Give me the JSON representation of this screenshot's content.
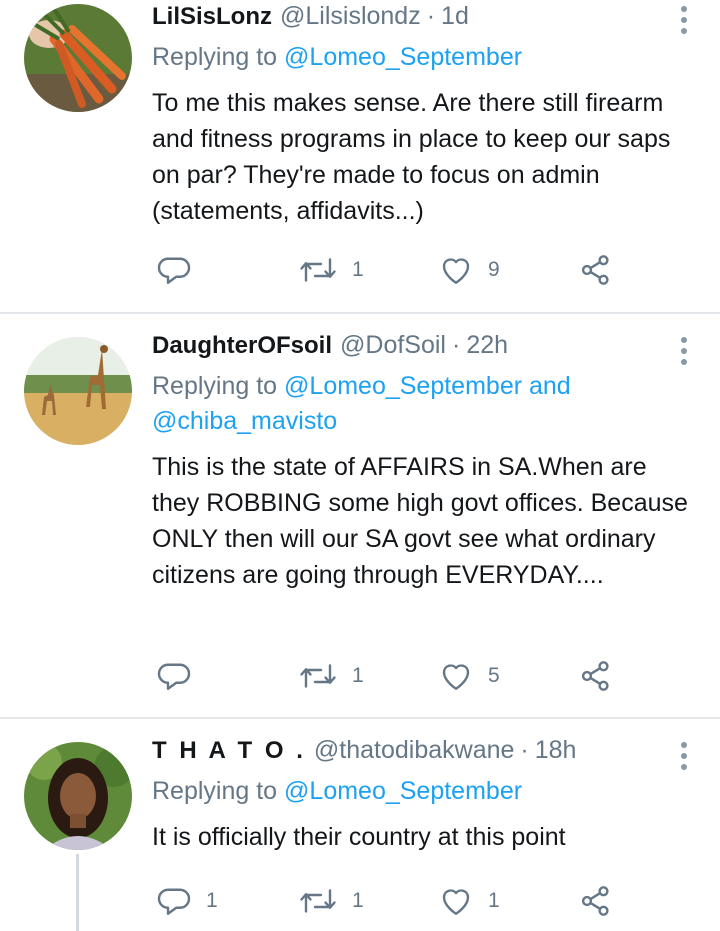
{
  "tweets": [
    {
      "name": "LilSisLonz",
      "handle": "@Lilsislondz",
      "dot": "·",
      "time": "1d",
      "replying_prefix": "Replying to",
      "replying_to": "@Lomeo_September",
      "replying_to_2": "",
      "text": "To me this makes sense. Are there still firearm and fitness programs in place to keep our saps on par? They're made to focus on admin (statements, affidavits...)",
      "reply_count": "",
      "retweet_count": "1",
      "like_count": "9"
    },
    {
      "name": "DaughterOFsoil",
      "handle": "@DofSoil",
      "dot": "·",
      "time": "22h",
      "replying_prefix": "Replying to",
      "replying_to": "@Lomeo_September",
      "replying_and": "and",
      "replying_to_2": "@chiba_mavisto",
      "text": "This is the state of AFFAIRS in SA.When are they ROBBING some high govt offices. Because ONLY then  will our SA govt see what ordinary citizens are going through EVERYDAY....",
      "reply_count": "",
      "retweet_count": "1",
      "like_count": "5"
    },
    {
      "name": "T H A T O .",
      "handle": "@thatodibakwane",
      "dot": "·",
      "time": "18h",
      "replying_prefix": "Replying to",
      "replying_to": "@Lomeo_September",
      "replying_to_2": "",
      "text": "It is officially their country at this point",
      "reply_count": "1",
      "retweet_count": "1",
      "like_count": "1"
    }
  ],
  "icons": {
    "reply": "reply-icon",
    "retweet": "retweet-icon",
    "like": "heart-icon",
    "share": "share-icon",
    "menu": "more-vertical-icon"
  },
  "colors": {
    "accent": "#1da1f2",
    "secondary_text": "#657786",
    "icon": "#657786",
    "divider": "#e3e6e8"
  }
}
